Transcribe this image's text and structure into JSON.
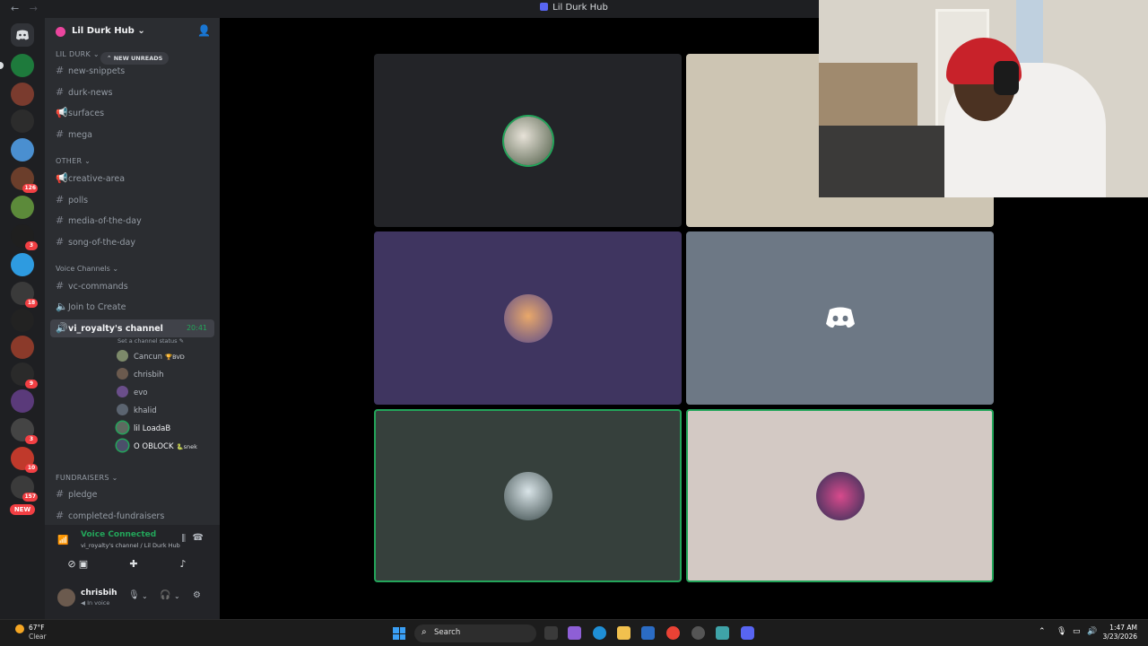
{
  "window": {
    "title": "Lil Durk Hub"
  },
  "guild": {
    "name": "Lil Durk Hub",
    "new_unreads": "NEW UNREADS"
  },
  "server_badges": [
    "126",
    "3",
    "18",
    "9",
    "3",
    "10",
    "157"
  ],
  "server_new": "NEW",
  "categories": {
    "lil_durk": "LIL DURK",
    "other": "OTHER",
    "voice": "Voice Channels",
    "fundraisers": "FUNDRAISERS"
  },
  "channels": {
    "new_snippets": "new-snippets",
    "durk_news": "durk-news",
    "surfaces": "surfaces",
    "mega": "mega",
    "creative_area": "creative-area",
    "polls": "polls",
    "media_of_the_day": "media-of-the-day",
    "song_of_the_day": "song-of-the-day",
    "vc_commands": "vc-commands",
    "join_to_create": "Join to Create",
    "active_voice": "vi_royalty's channel",
    "active_timer": "20:41",
    "active_status": "Set a channel status",
    "pledge": "pledge",
    "completed_fundraisers": "completed-fundraisers"
  },
  "voice_users": [
    {
      "name": "Cancun",
      "tag": "🏆BVD"
    },
    {
      "name": "chrisbih",
      "tag": ""
    },
    {
      "name": "evo",
      "tag": ""
    },
    {
      "name": "khalid",
      "tag": ""
    },
    {
      "name": "lil LoadaB",
      "tag": ""
    },
    {
      "name": "O OBLOCK",
      "tag": "🐍snek"
    }
  ],
  "voice_panel": {
    "title": "Voice Connected",
    "subtitle": "vi_royalty's channel / Lil Durk Hub"
  },
  "user_panel": {
    "name": "chrisbih",
    "status": "In voice"
  },
  "taskbar": {
    "temp": "67°F",
    "condition": "Clear",
    "search": "Search",
    "time": "1:47 AM",
    "date": "3/23/2026"
  },
  "colors": {
    "accent_green": "#23a55a",
    "blurple": "#5865f2",
    "tile_dark": "#232428",
    "tile_tan": "#cdc5b3",
    "tile_purple": "#3f3560",
    "tile_gray": "#6d7885",
    "tile_green": "#36403c",
    "tile_pink": "#d3c9c4"
  }
}
